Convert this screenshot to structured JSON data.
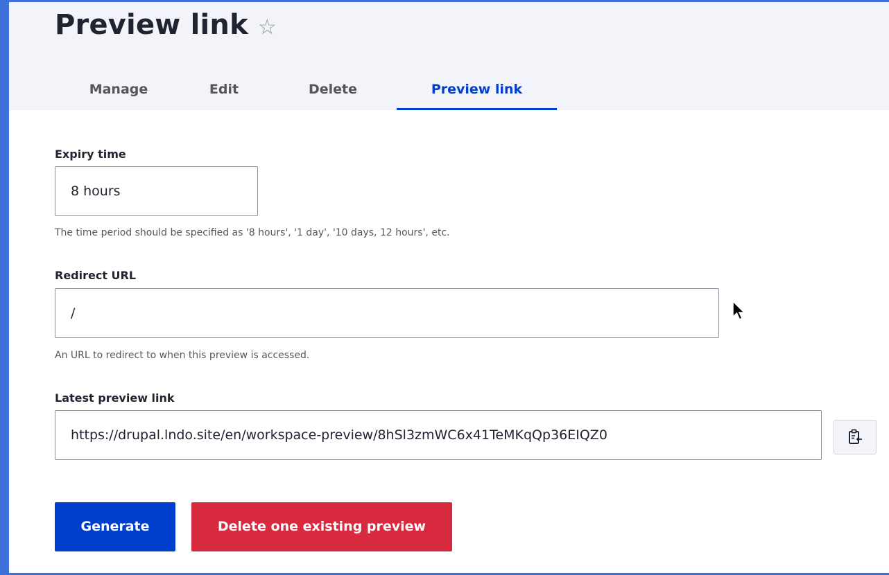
{
  "page": {
    "title": "Preview link",
    "favorite_icon": "star-outline-icon"
  },
  "tabs": [
    {
      "label": "Manage",
      "active": false
    },
    {
      "label": "Edit",
      "active": false
    },
    {
      "label": "Delete",
      "active": false
    },
    {
      "label": "Preview link",
      "active": true
    }
  ],
  "form": {
    "expiry": {
      "label": "Expiry time",
      "value": "8 hours",
      "description": "The time period should be specified as '8 hours', '1 day', '10 days, 12 hours', etc."
    },
    "redirect": {
      "label": "Redirect URL",
      "value": "/",
      "description": "An URL to redirect to when this preview is accessed."
    },
    "latest": {
      "label": "Latest preview link",
      "value": "https://drupal.lndo.site/en/workspace-preview/8hSl3zmWC6x41TeMKqQp36EIQZ0",
      "copy_icon": "clipboard-copy-icon"
    }
  },
  "actions": {
    "generate_label": "Generate",
    "delete_label": "Delete one existing preview"
  },
  "colors": {
    "accent": "#003ecc",
    "danger": "#d72a3e",
    "frame": "#3d6fd9",
    "header_bg": "#f3f4f9"
  }
}
